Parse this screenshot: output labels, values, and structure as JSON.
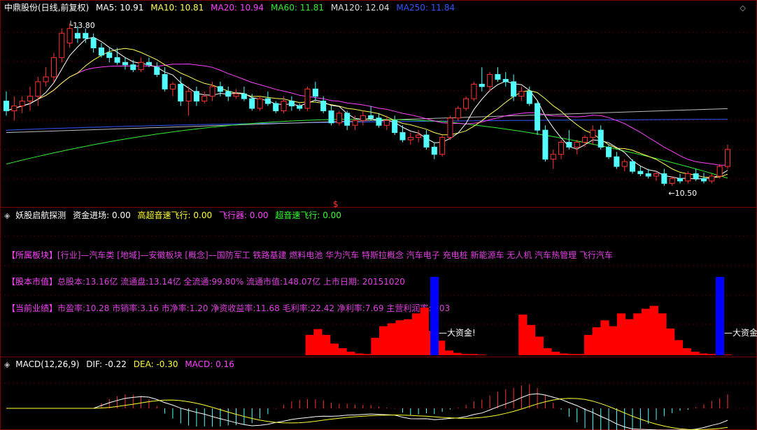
{
  "main": {
    "title": "中鼎股份(日线,前复权)",
    "ma": [
      {
        "label": "MA5: 10.91",
        "color": "#ffffff"
      },
      {
        "label": "MA10: 10.81",
        "color": "#ffff55"
      },
      {
        "label": "MA20: 10.94",
        "color": "#ff40ff"
      },
      {
        "label": "MA60: 11.81",
        "color": "#33ee33"
      },
      {
        "label": "MA120: 12.04",
        "color": "#dddddd"
      },
      {
        "label": "MA250: 11.84",
        "color": "#3355ff"
      }
    ],
    "high_label": "13.80",
    "low_label": "10.50",
    "marker": "$"
  },
  "indicator": {
    "title": "妖股启航探测",
    "items": [
      {
        "label": "资金进场: 0.00",
        "color": "#ffffff"
      },
      {
        "label": "高超音速飞行: 0.00",
        "color": "#ffff33"
      },
      {
        "label": "飞行器: 0.00",
        "color": "#ff40ff"
      },
      {
        "label": "超音速飞行: 0.00",
        "color": "#33ff33"
      }
    ],
    "info_lines": [
      {
        "tag": "【所属板块】",
        "text": "[行业]—汽车类 [地域]—安徽板块 [概念]—国防军工 铁路基建 燃料电池 华为汽车 特斯拉概念 汽车电子 充电桩 新能源车 无人机 汽车热管理 飞行汽车"
      },
      {
        "tag": "【股本市值】",
        "text": "总股本:13.16亿 流通盘:13.14亿 全流通:99.80% 流通市值:148.07亿 上市日期: 20151020"
      },
      {
        "tag": "【当前业绩】",
        "text": "市盈率:10.28 市销率:3.16 市净率:1.20 净资收益率:11.68 毛利率:22.42 净利率:7.69 主营利润率:6.03"
      }
    ],
    "signal_label": "大资金!"
  },
  "macd": {
    "title": "MACD(12,26,9)",
    "items": [
      {
        "label": "DIF: -0.22",
        "color": "#ffffff"
      },
      {
        "label": "DEA: -0.30",
        "color": "#ffff33"
      },
      {
        "label": "MACD: 0.16",
        "color": "#ff40ff"
      }
    ]
  },
  "colors": {
    "up": "#ff3232",
    "down": "#54ffff",
    "bar": "#ff0000",
    "signal": "#0000ff"
  },
  "chart_data": [
    {
      "type": "candlestick",
      "title": "中鼎股份(日线,前复权)",
      "note": "OHLC estimated from chart, oldest to newest",
      "ohlc": [
        [
          12.2,
          12.4,
          11.9,
          12.0
        ],
        [
          12.0,
          12.3,
          11.8,
          12.1
        ],
        [
          12.1,
          12.3,
          11.95,
          12.2
        ],
        [
          12.2,
          12.5,
          12.0,
          12.3
        ],
        [
          12.3,
          12.7,
          12.1,
          12.6
        ],
        [
          12.6,
          12.9,
          12.5,
          12.7
        ],
        [
          12.7,
          13.2,
          12.6,
          13.1
        ],
        [
          13.1,
          13.7,
          13.0,
          13.6
        ],
        [
          13.4,
          13.8,
          13.3,
          13.7
        ],
        [
          13.6,
          13.75,
          13.4,
          13.5
        ],
        [
          13.6,
          13.7,
          13.4,
          13.5
        ],
        [
          13.5,
          13.6,
          13.2,
          13.3
        ],
        [
          13.3,
          13.4,
          13.1,
          13.15
        ],
        [
          13.2,
          13.3,
          13.0,
          13.1
        ],
        [
          13.1,
          13.3,
          12.95,
          13.0
        ],
        [
          13.0,
          13.1,
          12.85,
          12.95
        ],
        [
          12.95,
          13.05,
          12.8,
          12.85
        ],
        [
          12.85,
          13.1,
          12.8,
          13.0
        ],
        [
          13.0,
          13.1,
          12.9,
          12.95
        ],
        [
          12.9,
          13.0,
          12.7,
          12.75
        ],
        [
          12.75,
          12.9,
          12.4,
          12.45
        ],
        [
          12.45,
          12.6,
          12.3,
          12.55
        ],
        [
          12.55,
          12.7,
          12.1,
          12.2
        ],
        [
          12.2,
          12.5,
          11.9,
          12.4
        ],
        [
          12.4,
          12.5,
          12.1,
          12.2
        ],
        [
          12.2,
          12.4,
          12.15,
          12.3
        ],
        [
          12.3,
          12.6,
          12.2,
          12.5
        ],
        [
          12.5,
          12.6,
          12.3,
          12.4
        ],
        [
          12.4,
          12.5,
          12.2,
          12.3
        ],
        [
          12.3,
          12.45,
          12.25,
          12.35
        ],
        [
          12.35,
          12.5,
          12.2,
          12.25
        ],
        [
          12.25,
          12.35,
          12.0,
          12.05
        ],
        [
          12.05,
          12.3,
          12.0,
          12.25
        ],
        [
          12.25,
          12.4,
          12.1,
          12.15
        ],
        [
          12.15,
          12.2,
          11.95,
          12.0
        ],
        [
          12.0,
          12.3,
          11.95,
          12.2
        ],
        [
          12.2,
          12.3,
          12.0,
          12.1
        ],
        [
          12.1,
          12.15,
          12.0,
          12.05
        ],
        [
          12.05,
          12.5,
          12.0,
          12.45
        ],
        [
          12.45,
          12.6,
          12.2,
          12.3
        ],
        [
          12.2,
          12.3,
          11.95,
          12.0
        ],
        [
          12.0,
          12.1,
          11.7,
          11.75
        ],
        [
          11.75,
          12.0,
          11.7,
          11.95
        ],
        [
          11.95,
          12.0,
          11.6,
          11.7
        ],
        [
          11.7,
          11.9,
          11.6,
          11.8
        ],
        [
          11.8,
          12.0,
          11.7,
          11.9
        ],
        [
          11.9,
          12.1,
          11.8,
          11.85
        ],
        [
          11.85,
          11.95,
          11.65,
          11.7
        ],
        [
          11.7,
          11.9,
          11.6,
          11.8
        ],
        [
          11.8,
          11.9,
          11.5,
          11.55
        ],
        [
          11.55,
          11.7,
          11.35,
          11.4
        ],
        [
          11.4,
          11.55,
          11.3,
          11.45
        ],
        [
          11.45,
          11.6,
          11.35,
          11.5
        ],
        [
          11.5,
          11.6,
          11.2,
          11.25
        ],
        [
          11.25,
          11.35,
          11.0,
          11.1
        ],
        [
          11.1,
          11.5,
          11.05,
          11.45
        ],
        [
          11.45,
          11.9,
          11.4,
          11.85
        ],
        [
          11.85,
          12.1,
          11.8,
          12.05
        ],
        [
          12.05,
          12.3,
          12.0,
          12.25
        ],
        [
          12.25,
          12.6,
          12.2,
          12.55
        ],
        [
          12.55,
          12.9,
          12.4,
          12.5
        ],
        [
          12.5,
          12.8,
          12.4,
          12.75
        ],
        [
          12.75,
          12.9,
          12.6,
          12.65
        ],
        [
          12.65,
          12.8,
          12.5,
          12.6
        ],
        [
          12.6,
          12.75,
          12.2,
          12.3
        ],
        [
          12.3,
          12.5,
          12.2,
          12.4
        ],
        [
          12.4,
          12.5,
          12.1,
          12.15
        ],
        [
          12.15,
          12.2,
          11.5,
          11.6
        ],
        [
          11.6,
          11.7,
          10.95,
          11.0
        ],
        [
          11.0,
          11.2,
          10.8,
          11.1
        ],
        [
          11.1,
          11.4,
          11.0,
          11.35
        ],
        [
          11.35,
          11.6,
          11.2,
          11.25
        ],
        [
          11.25,
          11.4,
          11.1,
          11.35
        ],
        [
          11.35,
          11.5,
          11.25,
          11.45
        ],
        [
          11.45,
          11.7,
          11.3,
          11.6
        ],
        [
          11.6,
          11.7,
          11.2,
          11.25
        ],
        [
          11.25,
          11.3,
          11.0,
          11.05
        ],
        [
          11.05,
          11.15,
          10.8,
          10.85
        ],
        [
          10.85,
          11.0,
          10.75,
          10.95
        ],
        [
          10.95,
          11.0,
          10.7,
          10.75
        ],
        [
          10.75,
          10.85,
          10.65,
          10.7
        ],
        [
          10.7,
          10.8,
          10.6,
          10.65
        ],
        [
          10.65,
          10.75,
          10.55,
          10.7
        ],
        [
          10.7,
          10.8,
          10.45,
          10.5
        ],
        [
          10.5,
          10.65,
          10.45,
          10.6
        ],
        [
          10.6,
          10.7,
          10.5,
          10.55
        ],
        [
          10.55,
          10.75,
          10.5,
          10.7
        ],
        [
          10.7,
          10.8,
          10.55,
          10.6
        ],
        [
          10.6,
          10.72,
          10.5,
          10.55
        ],
        [
          10.55,
          10.7,
          10.5,
          10.65
        ],
        [
          10.65,
          10.9,
          10.6,
          10.85
        ],
        [
          10.85,
          11.3,
          10.8,
          11.2
        ]
      ],
      "ylim": [
        10.1,
        14.0
      ],
      "high_annotation": 13.8,
      "low_annotation": 10.5,
      "series_labels": [
        "MA5: 10.91",
        "MA10: 10.81",
        "MA20: 10.94",
        "MA60: 11.81",
        "MA120: 12.04",
        "MA250: 11.84"
      ]
    },
    {
      "type": "bar",
      "title": "妖股启航探测",
      "note": "relative heights estimated",
      "bars": [
        0,
        0,
        0,
        0,
        0,
        0,
        0,
        0,
        0,
        0,
        0,
        0,
        0,
        0,
        0,
        0,
        0,
        0,
        0,
        0,
        0,
        0,
        0,
        0,
        0,
        0,
        0,
        0,
        0,
        0,
        0,
        0,
        0,
        0,
        0,
        0,
        0,
        0.35,
        0.45,
        0.35,
        0.2,
        0.12,
        0.06,
        0.03,
        0.02,
        0.3,
        0.5,
        0.55,
        0.6,
        0.62,
        0.72,
        0.82,
        0.42,
        0.25,
        0.08,
        0.04,
        0.02,
        0.02,
        0.01,
        0,
        0,
        0,
        0,
        0.7,
        0.52,
        0.32,
        0.12,
        0.06,
        0.03,
        0.02,
        0.02,
        0.35,
        0.48,
        0.6,
        0.5,
        0.72,
        0.62,
        0.72,
        0.8,
        0.85,
        0.72,
        0.46,
        0.26,
        0.12,
        0.06,
        0.03,
        0.02,
        0.01,
        0.01
      ],
      "signals": [
        {
          "label": "大资金!"
        },
        {
          "label": "大资金!"
        }
      ]
    },
    {
      "type": "macd",
      "title": "MACD(12,26,9)",
      "dif": -0.22,
      "dea": -0.3,
      "macd": 0.16
    }
  ]
}
